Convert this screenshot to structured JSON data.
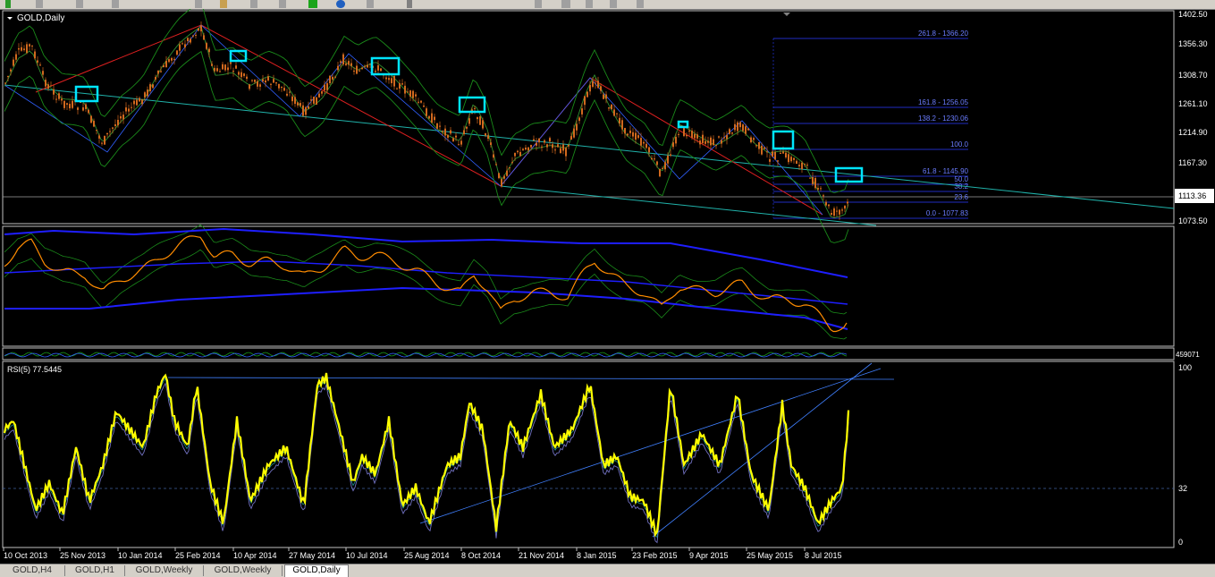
{
  "colors": {
    "accent": "#00ffff",
    "price_candle": "#d2691e",
    "rsi_line": "#ffff00",
    "bands": "#1a9a1a",
    "envelope": "#1e1eff"
  },
  "main_chart": {
    "title": "GOLD,Daily",
    "price_labels": [
      "1402.50",
      "1356.30",
      "1308.70",
      "1261.10",
      "1214.90",
      "1167.30",
      "1073.50"
    ],
    "current_price": "1113.36",
    "fib_levels": [
      "261.8 - 1366.20",
      "161.8 - 1256.05",
      "138.2 - 1230.06",
      "100.0",
      "61.8 - 1145.90",
      "50.0",
      "38.2",
      "23.6",
      "0.0 - 1077.83"
    ]
  },
  "indicator_panel": {
    "label": "459071"
  },
  "rsi_panel": {
    "title": "RSI(5) 77.5445",
    "scale": [
      "100",
      "32",
      "0"
    ]
  },
  "date_axis": [
    "10 Oct 2013",
    "25 Nov 2013",
    "10 Jan 2014",
    "25 Feb 2014",
    "10 Apr 2014",
    "27 May 2014",
    "10 Jul 2014",
    "25 Aug 2014",
    "8 Oct 2014",
    "21 Nov 2014",
    "8 Jan 2015",
    "23 Feb 2015",
    "9 Apr 2015",
    "25 May 2015",
    "8 Jul 2015"
  ],
  "tabs": [
    "GOLD,H4",
    "GOLD,H1",
    "GOLD,Weekly",
    "GOLD,Weekly",
    "GOLD,Daily"
  ]
}
